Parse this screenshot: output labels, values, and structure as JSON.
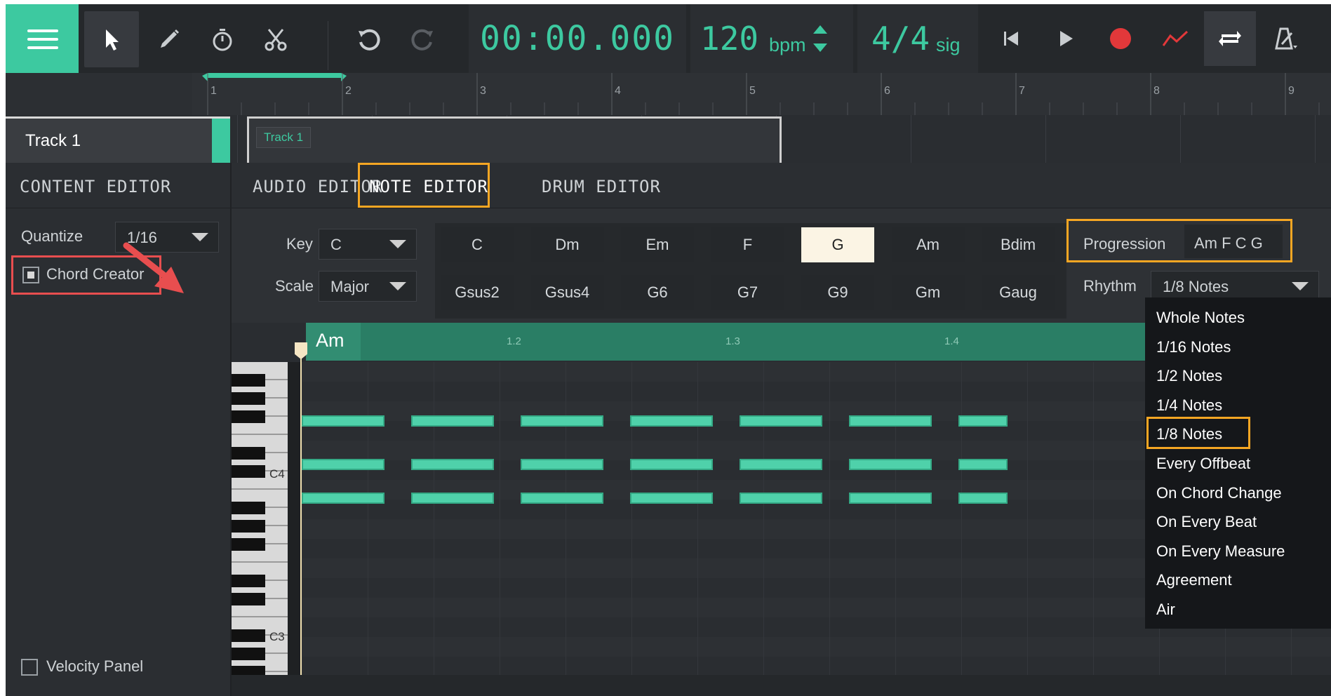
{
  "toolbar": {
    "time": "00:00.000",
    "bpm_value": "120",
    "bpm_unit": "bpm",
    "sig_value": "4/4",
    "sig_unit": "sig",
    "tools": [
      "menu-icon",
      "pointer-icon",
      "pencil-icon",
      "stopwatch-icon",
      "scissors-icon",
      "undo-icon",
      "redo-icon"
    ],
    "transport": [
      "skip-to-start-icon",
      "play-icon",
      "record-icon",
      "automation-icon",
      "loop-icon",
      "metronome-icon"
    ],
    "accent_color": "#3dc9a0",
    "record_color": "#e2383a"
  },
  "timeline": {
    "bar_numbers": [
      "1",
      "2",
      "3",
      "4",
      "5",
      "6",
      "7",
      "8",
      "9"
    ],
    "track_name": "Track 1",
    "clip_label": "Track 1"
  },
  "content_editor": {
    "title": "CONTENT EDITOR",
    "quantize_label": "Quantize",
    "quantize_value": "1/16",
    "chord_creator_label": "Chord Creator",
    "velocity_panel_label": "Velocity Panel"
  },
  "note_editor": {
    "tabs": [
      "AUDIO EDITOR",
      "NOTE EDITOR",
      "DRUM EDITOR"
    ],
    "key_label": "Key",
    "key_value": "C",
    "scale_label": "Scale",
    "scale_value": "Major",
    "chords_row1": [
      "C",
      "Dm",
      "Em",
      "F",
      "G",
      "Am",
      "Bdim"
    ],
    "chords_row2": [
      "Gsus2",
      "Gsus4",
      "G6",
      "G7",
      "G9",
      "Gm",
      "Gaug"
    ],
    "selected_chord": "G",
    "progression_label": "Progression",
    "progression_value": "Am F C G",
    "rhythm_label": "Rhythm",
    "rhythm_value": "1/8 Notes",
    "rhythm_options": [
      "Whole Notes",
      "1/16 Notes",
      "1/2 Notes",
      "1/4 Notes",
      "1/8 Notes",
      "Every Offbeat",
      "On Chord Change",
      "On Every Beat",
      "On Every Measure",
      "Agreement",
      "Air"
    ]
  },
  "piano_roll": {
    "chord_label": "Am",
    "beat_labels": [
      "1.2",
      "1.3",
      "1.4"
    ],
    "key_labels": [
      "C4",
      "C3"
    ]
  }
}
